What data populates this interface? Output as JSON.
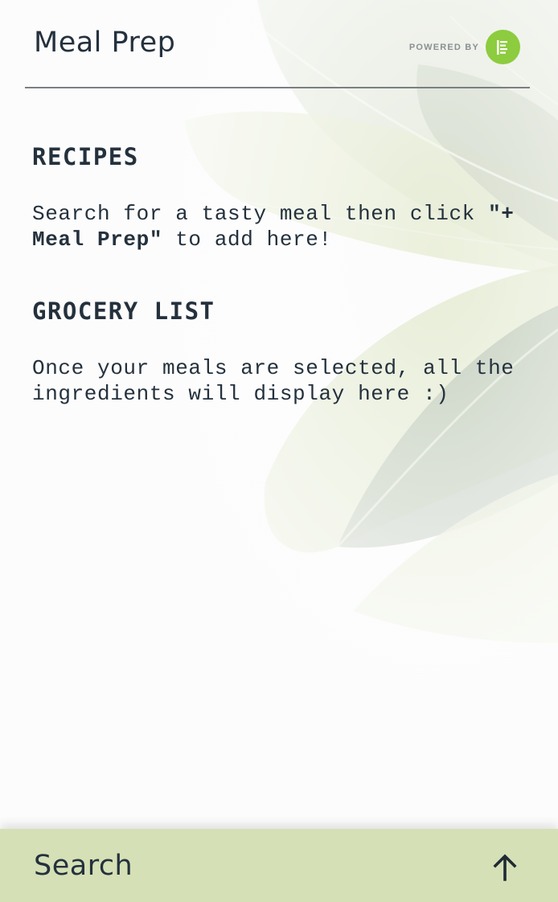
{
  "header": {
    "title": "Meal Prep",
    "powered_by_label": "POWERED BY",
    "brand_logo_icon": "edamam-lines-icon",
    "brand_color": "#8ccc3e"
  },
  "recipes": {
    "heading": "RECIPES",
    "text_before": "Search for a tasty meal then click ",
    "text_strong": "\"+ Meal Prep\"",
    "text_after": " to add here!"
  },
  "grocery_list": {
    "heading": "GROCERY LIST",
    "text": "Once your meals are selected, all the ingredients will display here :)"
  },
  "bottom_bar": {
    "label": "Search",
    "icon": "arrow-up-icon",
    "background_color": "#d5e0b6"
  },
  "colors": {
    "text": "#24313d",
    "divider": "#7a7f83",
    "page_background": "#fcfcfc"
  }
}
